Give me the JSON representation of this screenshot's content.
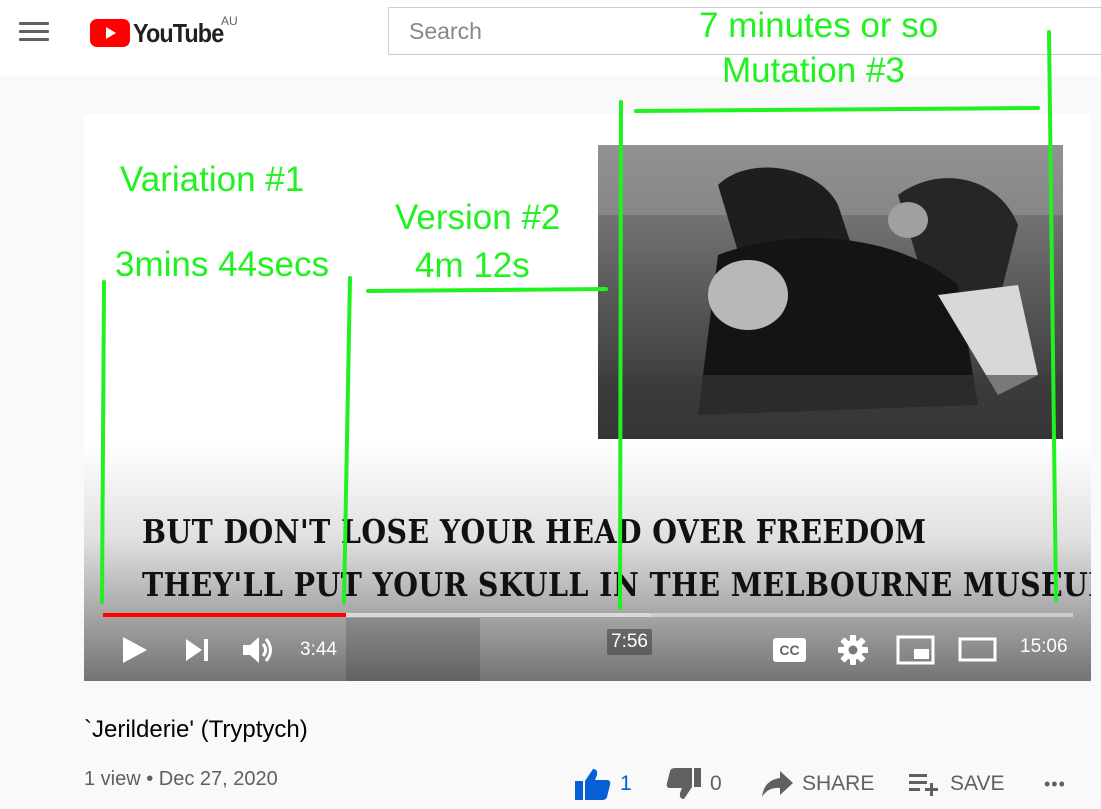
{
  "header": {
    "logo_text": "YouTube",
    "region": "AU",
    "search_placeholder": "Search"
  },
  "player": {
    "subtitle_line1": "BUT DON'T LOSE YOUR HEAD OVER FREEDOM",
    "subtitle_line2": "THEY'LL PUT YOUR SKULL IN THE MELBOURNE MUSEUM",
    "time_current": "3:44",
    "time_hover": "7:56",
    "time_total": "15:06",
    "progress_played": 0.25,
    "progress_buffered": 0.565,
    "cc_label": "CC"
  },
  "annotations": {
    "label1": "Variation #1",
    "label1_time": "3mins 44secs",
    "label2": "Version #2",
    "label2_time": "4m 12s",
    "label3": "7 minutes or so",
    "label3_name": "Mutation #3",
    "color": "#1ff21f"
  },
  "video": {
    "title": "`Jerilderie' (Tryptych)",
    "meta": "1 view • Dec 27, 2020",
    "likes": "1",
    "dislikes": "0",
    "share_label": "SHARE",
    "save_label": "SAVE",
    "more_label": "•••"
  },
  "colors": {
    "brand_red": "#ff0000",
    "like_blue": "#065fd4"
  }
}
